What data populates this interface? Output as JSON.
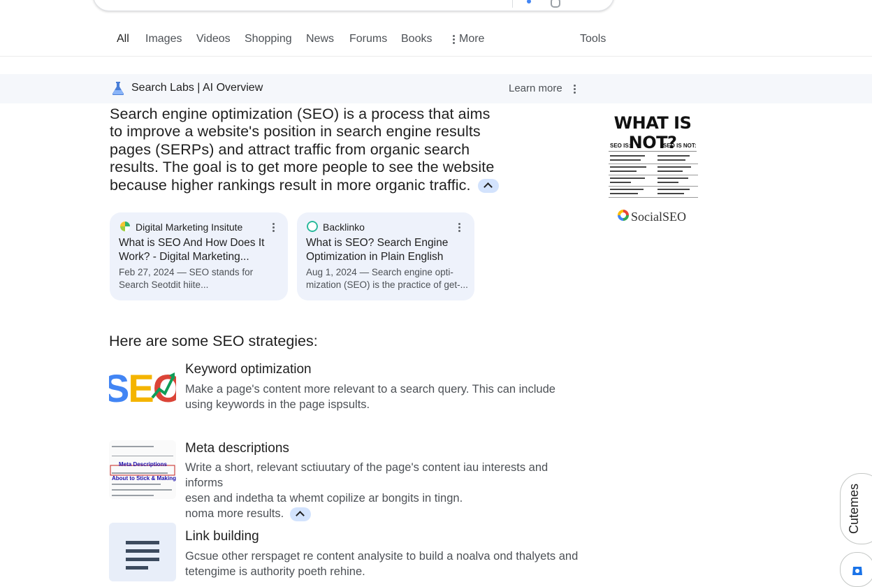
{
  "tabs": [
    {
      "label": "All",
      "active": true
    },
    {
      "label": "Images"
    },
    {
      "label": "Videos"
    },
    {
      "label": "Shopping"
    },
    {
      "label": "News"
    },
    {
      "label": "Forums"
    },
    {
      "label": "Books"
    },
    {
      "label": "More"
    }
  ],
  "tools_label": "Tools",
  "ai_overview": {
    "title": "Search Labs | AI Overview",
    "learn_more": "Learn more",
    "summary": "Search engine optimization (SEO) is a process that aims to improve a website's position in search engine results pages (SERPs) and attract traffic from organic search results. The goal is to get more people to see the website because higher rankings result in more organic traffic."
  },
  "sources": [
    {
      "site": "Digital Marketing Insitute",
      "title": "What is SEO And How Does It Work? - Digital Marketing...",
      "snippet": "Feb 27, 2024 — SEO stands for Search Seotdit hiite..."
    },
    {
      "site": "Backlinko",
      "title": "What is SEO? Search Engine Optimization in Plain English",
      "snippet": "Aug 1, 2024 — Search engine opti- mization (SEO) is the practice of get-..."
    }
  ],
  "side_image": {
    "heading": "WHAT IS NOT?",
    "left_col": "SEO IS:",
    "right_col": "SEO IS NOT:",
    "brand": "SocialSEO"
  },
  "strategies_heading": "Here are some SEO strategies:",
  "strategies": [
    {
      "title": "Keyword optimization",
      "desc": "Make a page's content more relevant to a search query. This can include using keywords in the page ispsults.",
      "image_text": "SEO"
    },
    {
      "title": "Meta descriptions",
      "desc_lines": [
        "Write a short, relevant sctiuutary of the page's content iau interests and informs",
        "esen and indetha ta whemt copilize ar bongits in tingn.",
        "noma more results."
      ],
      "image_lines": [
        "Meta Descriptions",
        "About to Stick & Making You"
      ]
    },
    {
      "title": "Link building",
      "desc": "Gcsue other rerspaget re content analysite to build a noalva ond thalyets and tetengime is authority poeth rehine."
    }
  ],
  "feedback_label": "Cutemes",
  "colors": {
    "accent_pill": "#d3e3fd",
    "card_bg": "#eef2fb",
    "band_bg": "#f5f7fb"
  }
}
